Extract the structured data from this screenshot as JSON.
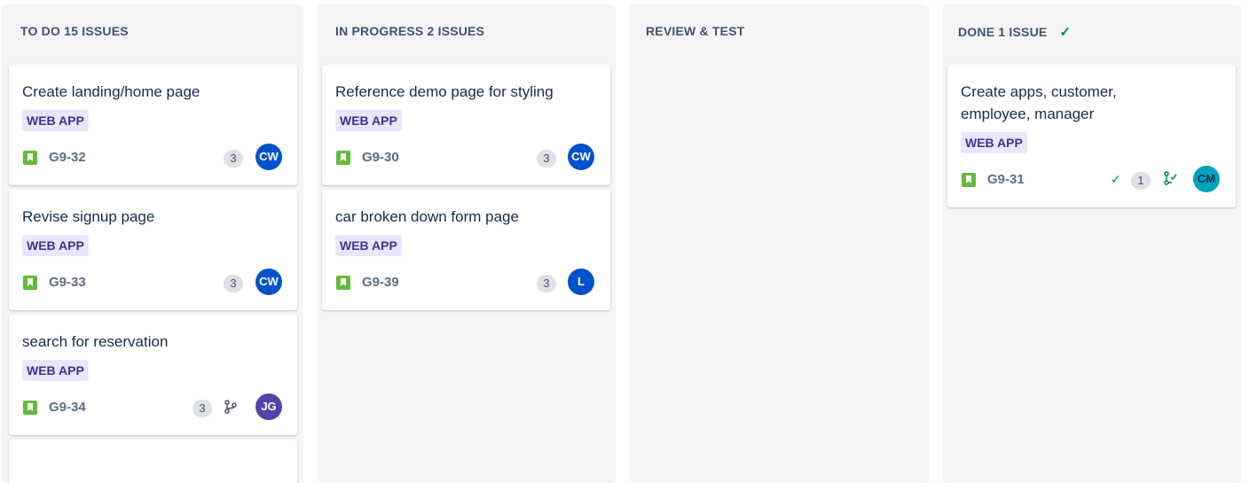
{
  "columns": {
    "todo": {
      "header": "TO DO 15 ISSUES",
      "cards": [
        {
          "title": "Create landing/home page",
          "label": "WEB APP",
          "key": "G9-32",
          "points": "3",
          "assignee": "CW"
        },
        {
          "title": "Revise signup page",
          "label": "WEB APP",
          "key": "G9-33",
          "points": "3",
          "assignee": "CW"
        },
        {
          "title": "search for reservation",
          "label": "WEB APP",
          "key": "G9-34",
          "points": "3",
          "assignee": "JG"
        }
      ]
    },
    "progress": {
      "header": "IN PROGRESS 2 ISSUES",
      "cards": [
        {
          "title": "Reference demo page for styling",
          "label": "WEB APP",
          "key": "G9-30",
          "points": "3",
          "assignee": "CW"
        },
        {
          "title": "car broken down form page",
          "label": "WEB APP",
          "key": "G9-39",
          "points": "3",
          "assignee": "L"
        }
      ]
    },
    "review": {
      "header": "REVIEW & TEST"
    },
    "done": {
      "header": "DONE 1 ISSUE",
      "check": "✓",
      "cards": [
        {
          "title": "Create apps, customer, employee, manager",
          "label": "WEB APP",
          "key": "G9-31",
          "check": "✓",
          "points": "1",
          "assignee": "CM"
        }
      ]
    }
  },
  "colors": {
    "avatar_cw": "#0052cc",
    "avatar_l": "#0052cc",
    "avatar_jg": "#5243aa",
    "avatar_cm": "#00a3bf",
    "label_bg": "#eae6ff",
    "label_text": "#403294",
    "story": "#63ba3c"
  },
  "icons": {
    "story": "bookmark-story-icon",
    "branch": "git-branch-icon",
    "merged": "merged-branch-icon",
    "done": "check-icon"
  }
}
